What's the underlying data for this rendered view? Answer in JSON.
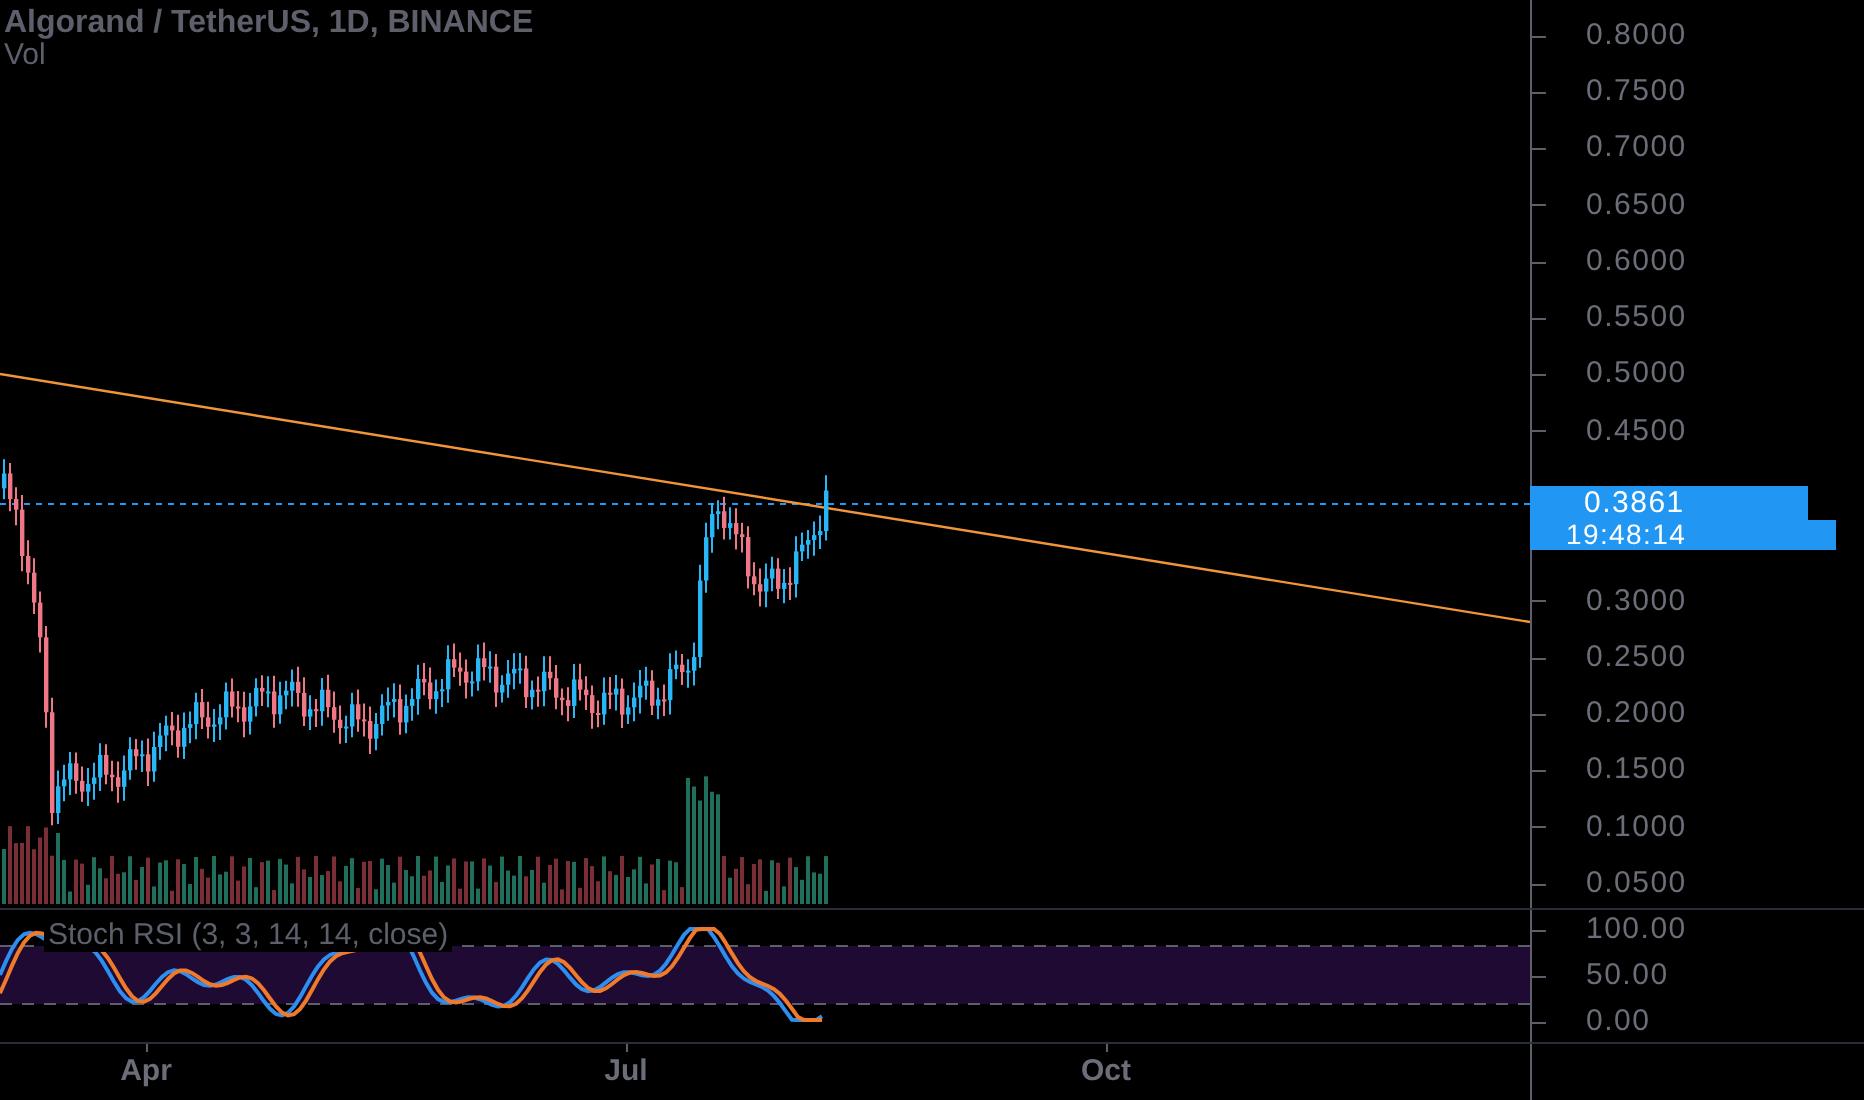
{
  "header": {
    "title": "Algorand / TetherUS, 1D, BINANCE",
    "volume_label": "Vol"
  },
  "price_axis": {
    "upper_ticks": [
      "0.8000",
      "0.7500",
      "0.7000",
      "0.6500",
      "0.6000",
      "0.5500",
      "0.5000",
      "0.4500"
    ],
    "lower_ticks": [
      "0.3000",
      "0.2500",
      "0.2000",
      "0.1500",
      "0.1000",
      "0.0500"
    ]
  },
  "current_price": {
    "price": "0.3861",
    "countdown": "19:48:14"
  },
  "indicator": {
    "label": "Stoch RSI (3, 3, 14, 14, close)",
    "ticks": [
      "100.00",
      "50.00",
      "0.00"
    ]
  },
  "time_axis": {
    "ticks": [
      "Apr",
      "Jul",
      "Oct"
    ]
  }
}
